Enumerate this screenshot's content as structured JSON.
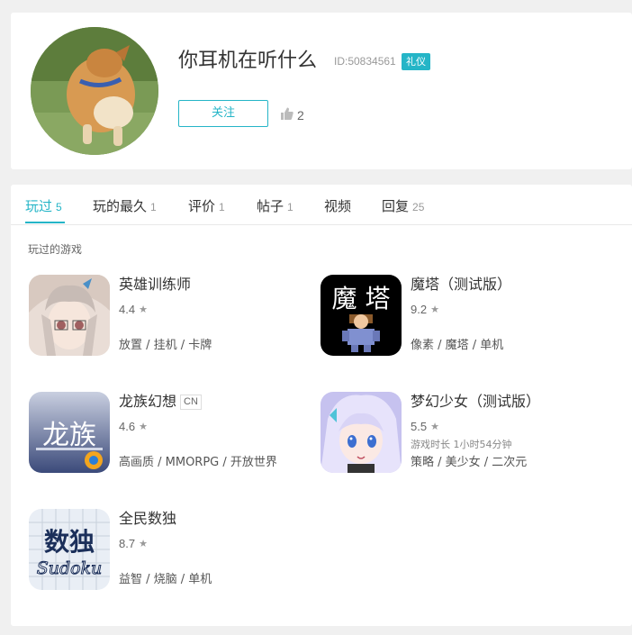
{
  "profile": {
    "username": "你耳机在听什么",
    "uid": "ID:50834561",
    "badge": "礼仪",
    "follow_label": "关注",
    "likes": "2",
    "avatar_icon": "dog-photo-avatar"
  },
  "tabs": [
    {
      "label": "玩过",
      "count": "5",
      "active": true
    },
    {
      "label": "玩的最久",
      "count": "1"
    },
    {
      "label": "评价",
      "count": "1"
    },
    {
      "label": "帖子",
      "count": "1"
    },
    {
      "label": "视频",
      "count": ""
    },
    {
      "label": "回复",
      "count": "25"
    }
  ],
  "section_title": "玩过的游戏",
  "games": [
    {
      "name": "英雄训练师",
      "rating": "4.4",
      "tags": "放置 / 挂机 / 卡牌",
      "icon": "anime-girl-icon"
    },
    {
      "name": "魔塔（测试版）",
      "rating": "9.2",
      "tags": "像素 / 魔塔 / 单机",
      "icon": "magic-tower-icon",
      "icon_text": "魔 塔"
    },
    {
      "name": "龙族幻想",
      "tag": "CN",
      "rating": "4.6",
      "tags": "高画质 / MMORPG / 开放世界",
      "icon": "dragon-raja-icon",
      "icon_text": "龙族"
    },
    {
      "name": "梦幻少女（测试版）",
      "rating": "5.5",
      "playtime": "游戏时长 1小时54分钟",
      "tags": "策略 / 美少女 / 二次元",
      "icon": "anime-elf-girl-icon"
    },
    {
      "name": "全民数独",
      "rating": "8.7",
      "tags": "益智 / 烧脑 / 单机",
      "icon": "sudoku-icon",
      "icon_text": "数独",
      "icon_subtext": "Sudoku"
    }
  ],
  "colors": {
    "accent": "#25b5c7",
    "background": "#f0f0f0"
  }
}
